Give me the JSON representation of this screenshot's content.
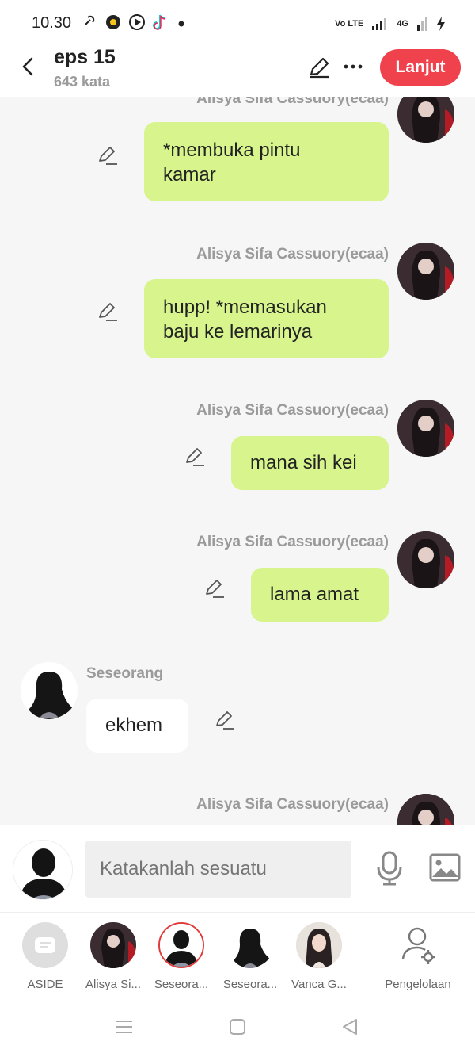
{
  "status": {
    "time": "10.30",
    "net_labels": [
      "Vo LTE",
      "4G"
    ]
  },
  "header": {
    "title": "eps 15",
    "word_count": "643 kata",
    "next_label": "Lanjut"
  },
  "messages": [
    {
      "sender": "Alisya Sifa Cassuory(ecaa)",
      "side": "right",
      "text_lines": [
        "*membuka pintu",
        "kamar"
      ]
    },
    {
      "sender": "Alisya Sifa Cassuory(ecaa)",
      "side": "right",
      "text_lines": [
        "hupp! *memasukan",
        "baju ke lemarinya"
      ]
    },
    {
      "sender": "Alisya Sifa Cassuory(ecaa)",
      "side": "right",
      "text_lines": [
        "mana sih kei"
      ]
    },
    {
      "sender": "Alisya Sifa Cassuory(ecaa)",
      "side": "right",
      "text_lines": [
        "lama amat"
      ]
    },
    {
      "sender": "Seseorang",
      "side": "left",
      "text_lines": [
        "ekhem"
      ]
    },
    {
      "sender": "Alisya Sifa Cassuory(ecaa)",
      "side": "right",
      "text_lines": []
    }
  ],
  "input": {
    "placeholder": "Katakanlah sesuatu"
  },
  "characters": [
    {
      "label": "ASIDE",
      "icon": "aside-icon"
    },
    {
      "label": "Alisya Si...",
      "icon": "avatar"
    },
    {
      "label": "Seseora...",
      "icon": "avatar",
      "selected": true
    },
    {
      "label": "Seseora...",
      "icon": "avatar"
    },
    {
      "label": "Vanca G...",
      "icon": "avatar"
    },
    {
      "label": "Pengelolaan",
      "icon": "manage-user-icon"
    }
  ],
  "colors": {
    "accent": "#f0424d",
    "bubble_green": "#d7f48d",
    "name_gray": "#9a9a9a"
  }
}
